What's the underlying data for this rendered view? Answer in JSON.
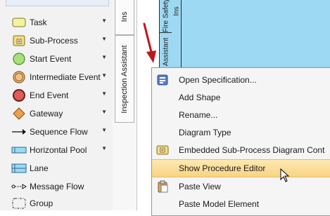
{
  "palette": {
    "items": [
      {
        "label": "Task",
        "icon": "task-icon",
        "has_arrow": true
      },
      {
        "label": "Sub-Process",
        "icon": "sub-process-icon",
        "has_arrow": true
      },
      {
        "label": "Start Event",
        "icon": "start-event-icon",
        "has_arrow": true
      },
      {
        "label": "Intermediate Event",
        "icon": "intermediate-event-icon",
        "has_arrow": true
      },
      {
        "label": "End Event",
        "icon": "end-event-icon",
        "has_arrow": true
      },
      {
        "label": "Gateway",
        "icon": "gateway-icon",
        "has_arrow": true
      },
      {
        "label": "Sequence Flow",
        "icon": "sequence-flow-icon",
        "has_arrow": true
      },
      {
        "label": "Horizontal Pool",
        "icon": "horizontal-pool-icon",
        "has_arrow": true
      },
      {
        "label": "Lane",
        "icon": "lane-icon",
        "has_arrow": false
      },
      {
        "label": "Message Flow",
        "icon": "message-flow-icon",
        "has_arrow": false
      },
      {
        "label": "Group",
        "icon": "group-icon",
        "has_arrow": false
      }
    ]
  },
  "tabs": {
    "inspection_short": "Ins",
    "inspection_assistant": "Inspection Assistant"
  },
  "diagram": {
    "lane_fire_safety": "Fire Safety",
    "lane_inner_top": "Ins",
    "lane_assistant": "Assistant"
  },
  "context_menu": {
    "items": [
      {
        "label": "Open Specification...",
        "icon": "specification-icon",
        "highlighted": false
      },
      {
        "label": "Add Shape",
        "icon": "",
        "highlighted": false
      },
      {
        "label": "Rename...",
        "icon": "",
        "highlighted": false
      },
      {
        "label": "Diagram Type",
        "icon": "",
        "highlighted": false
      },
      {
        "label": "Embedded Sub-Process Diagram Cont",
        "icon": "embedded-subprocess-icon",
        "highlighted": false
      },
      {
        "label": "Show Procedure Editor",
        "icon": "",
        "highlighted": true
      },
      {
        "label": "Paste View",
        "icon": "paste-icon",
        "highlighted": false
      },
      {
        "label": "Paste Model Element",
        "icon": "",
        "highlighted": false
      }
    ]
  },
  "colors": {
    "diagram_fill": "#9ed9f3",
    "menu_highlight": "#f7d483",
    "annotation_arrow": "#c0161b"
  }
}
